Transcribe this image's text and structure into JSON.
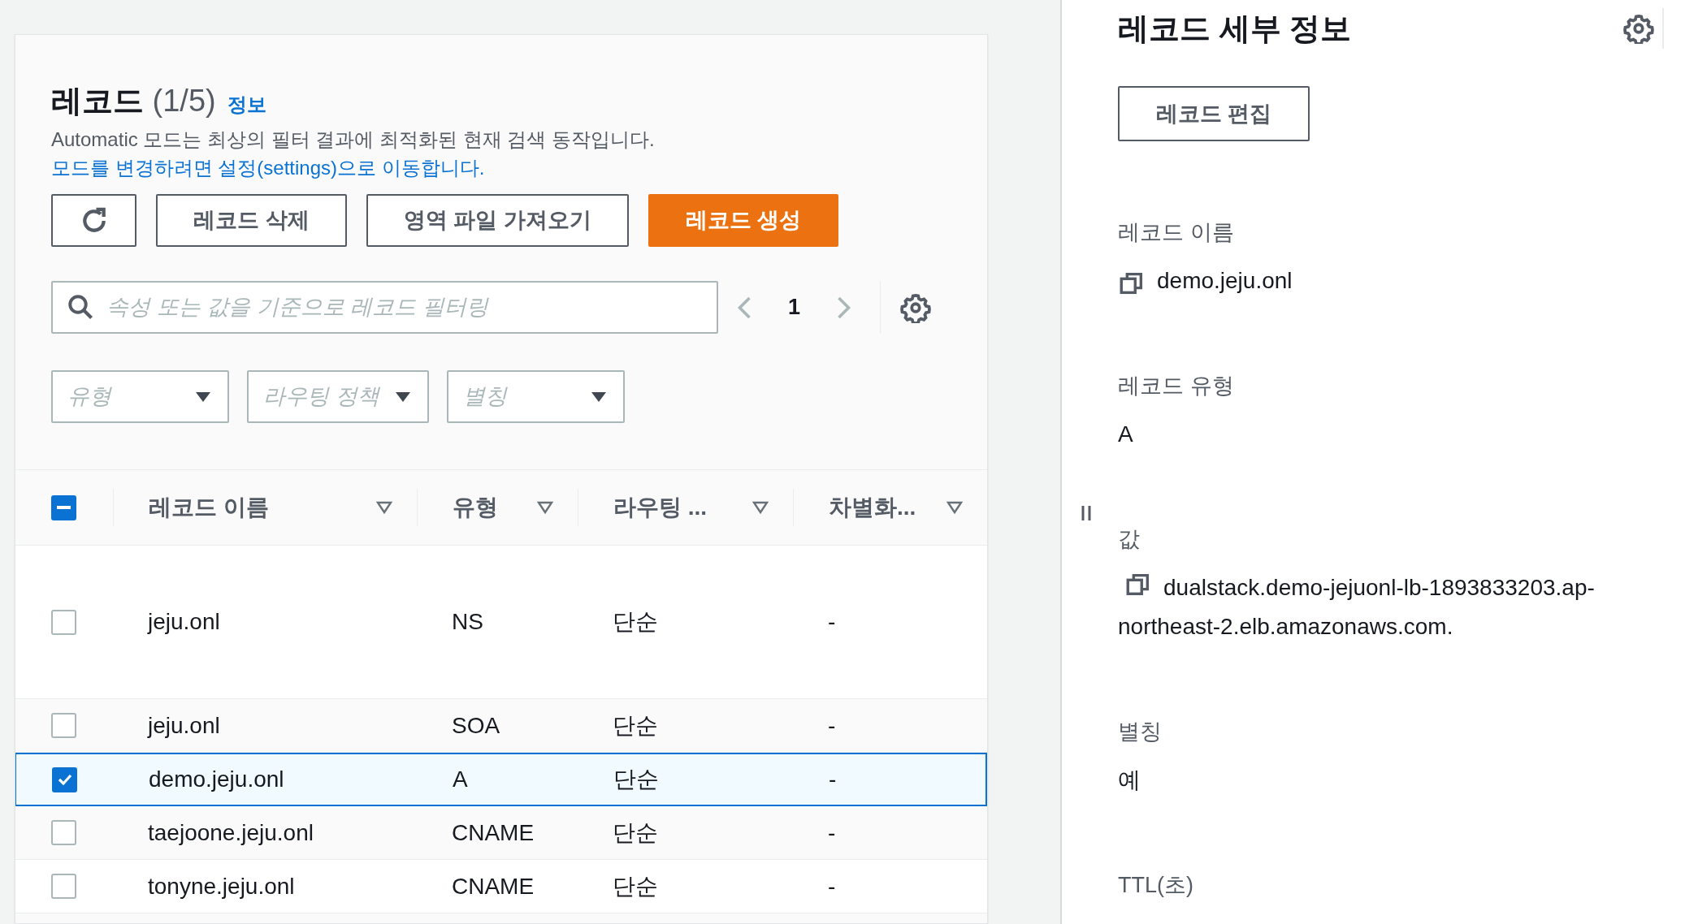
{
  "records_panel": {
    "title": "레코드",
    "count": "(1/5)",
    "info_link": "정보",
    "description": "Automatic 모드는 최상의 필터 결과에 최적화된 현재 검색 동작입니다.",
    "settings_link": "모드를 변경하려면 설정(settings)으로 이동합니다.",
    "buttons": [
      {
        "kind": "refresh"
      },
      {
        "kind": "normal",
        "label": "레코드 삭제"
      },
      {
        "kind": "normal",
        "label": "영역 파일 가져오기"
      },
      {
        "kind": "primary",
        "label": "레코드 생성"
      }
    ],
    "search": {
      "placeholder": "속성 또는 값을 기준으로 레코드 필터링"
    },
    "pagination": {
      "page": "1",
      "prev_disabled": true,
      "next_disabled": true
    },
    "filters": [
      {
        "placeholder": "유형"
      },
      {
        "placeholder": "라우팅 정책"
      },
      {
        "placeholder": "별칭"
      }
    ],
    "table": {
      "select_all": {
        "indeterminate": true
      },
      "columns": [
        {
          "label": "레코드 이름"
        },
        {
          "label": "유형"
        },
        {
          "label": "라우팅 ..."
        },
        {
          "label": "차별화..."
        }
      ],
      "rows": [
        {
          "name": "jeju.onl",
          "type": "NS",
          "routing": "단순",
          "differentiator": "-",
          "selected": false
        },
        {
          "name": "jeju.onl",
          "type": "SOA",
          "routing": "단순",
          "differentiator": "-",
          "selected": false
        },
        {
          "name": "demo.jeju.onl",
          "type": "A",
          "routing": "단순",
          "differentiator": "-",
          "selected": true
        },
        {
          "name": "taejoone.jeju.onl",
          "type": "CNAME",
          "routing": "단순",
          "differentiator": "-",
          "selected": false
        },
        {
          "name": "tonyne.jeju.onl",
          "type": "CNAME",
          "routing": "단순",
          "differentiator": "-",
          "selected": false
        }
      ]
    }
  },
  "details_panel": {
    "title": "레코드 세부 정보",
    "edit_button": "레코드 편집",
    "fields": [
      {
        "label": "레코드 이름",
        "value": "demo.jeju.onl",
        "copyable": true
      },
      {
        "label": "레코드 유형",
        "value": "A"
      },
      {
        "label": "값",
        "value": "dualstack.demo-jejuonl-lb-1893833203.ap-northeast-2.elb.amazonaws.com.",
        "copyable": true
      },
      {
        "label": "별칭",
        "value": "예"
      },
      {
        "label": "TTL(초)"
      }
    ]
  }
}
